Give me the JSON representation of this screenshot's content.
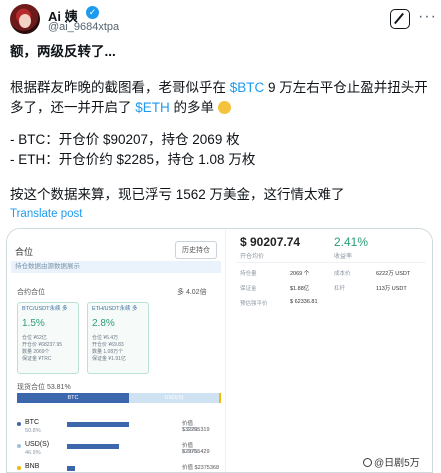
{
  "tweet": {
    "author_name": "Ai 姨",
    "handle": "@ai_9684xtpa",
    "title": "额，两级反转了...",
    "p1_pre": "根据群友昨晚的截图看，老哥似乎在 ",
    "p1_btc": "$BTC",
    "p1_mid": " 9 万左右平仓止盈并扭头开多了，还一并开启了 ",
    "p1_eth": "$ETH",
    "p1_post": " 的多单",
    "btc_line": "- BTC：开仓价 $90207，持仓 2069 枚",
    "eth_line": "- ETH：开仓价约 $2285，持仓 1.08 万枚",
    "p3": "按这个数据来算，现已浮亏 1562 万美金，这行情太难了",
    "translate": "Translate post"
  },
  "screenshot": {
    "title": "合位",
    "history_btn": "历史持仓",
    "strip_text": "持仓数据由源数据展示",
    "total_label": "合约合位",
    "total_value": "多 4.02倍",
    "card_btc": {
      "title": "BTC/USDT永续 多",
      "pct": "1.5%",
      "l1": "仓位 ¥62亿",
      "l2": "开仓价 ¥68237.95",
      "l3": "数量 2069个",
      "l4": "保证金 ¥TRC"
    },
    "card_eth": {
      "title": "ETH/USDT永续 多",
      "pct": "2.8%",
      "l1": "仓位 ¥6.4万",
      "l2": "开仓价 ¥69.83",
      "l3": "数量 1.08万个",
      "l4": "保证金 ¥1.91亿"
    },
    "ratio_label": "现货合位 53.81%",
    "ratio_btc": "BTC",
    "ratio_usd": "USD(S)",
    "assets": [
      {
        "name": "BTC",
        "pct": "50.8%",
        "v1": "价值 $32295319",
        "v2": "1.19%",
        "bar": 0.62
      },
      {
        "name": "USD(S)",
        "pct": "46.9%",
        "v1": "价值 $29755429",
        "v2": "0.00%",
        "bar": 0.52
      },
      {
        "name": "BNB",
        "pct": "",
        "v1": "价值 $2375368",
        "v2": "",
        "bar": 0.08
      }
    ],
    "right": {
      "price": "$ 90207.74",
      "pct": "2.41%",
      "sub1": "开仓均价",
      "sub2": "收益率",
      "k1": "持仓量",
      "v1": "2069 个",
      "k2": "成本价",
      "v2": "6222万 USDT",
      "k3": "保证金",
      "v3": "$1.88亿",
      "k4": "杠杆",
      "v4": "113万 USDT",
      "k5": "预估强平价",
      "v5": "$ 62336.81"
    },
    "colors": {
      "btc": "#3c67ad",
      "usd": "#cfe2f2",
      "bnb": "#f0b90b",
      "profit": "#2a9d74"
    }
  },
  "watermark": "@日剧5万"
}
